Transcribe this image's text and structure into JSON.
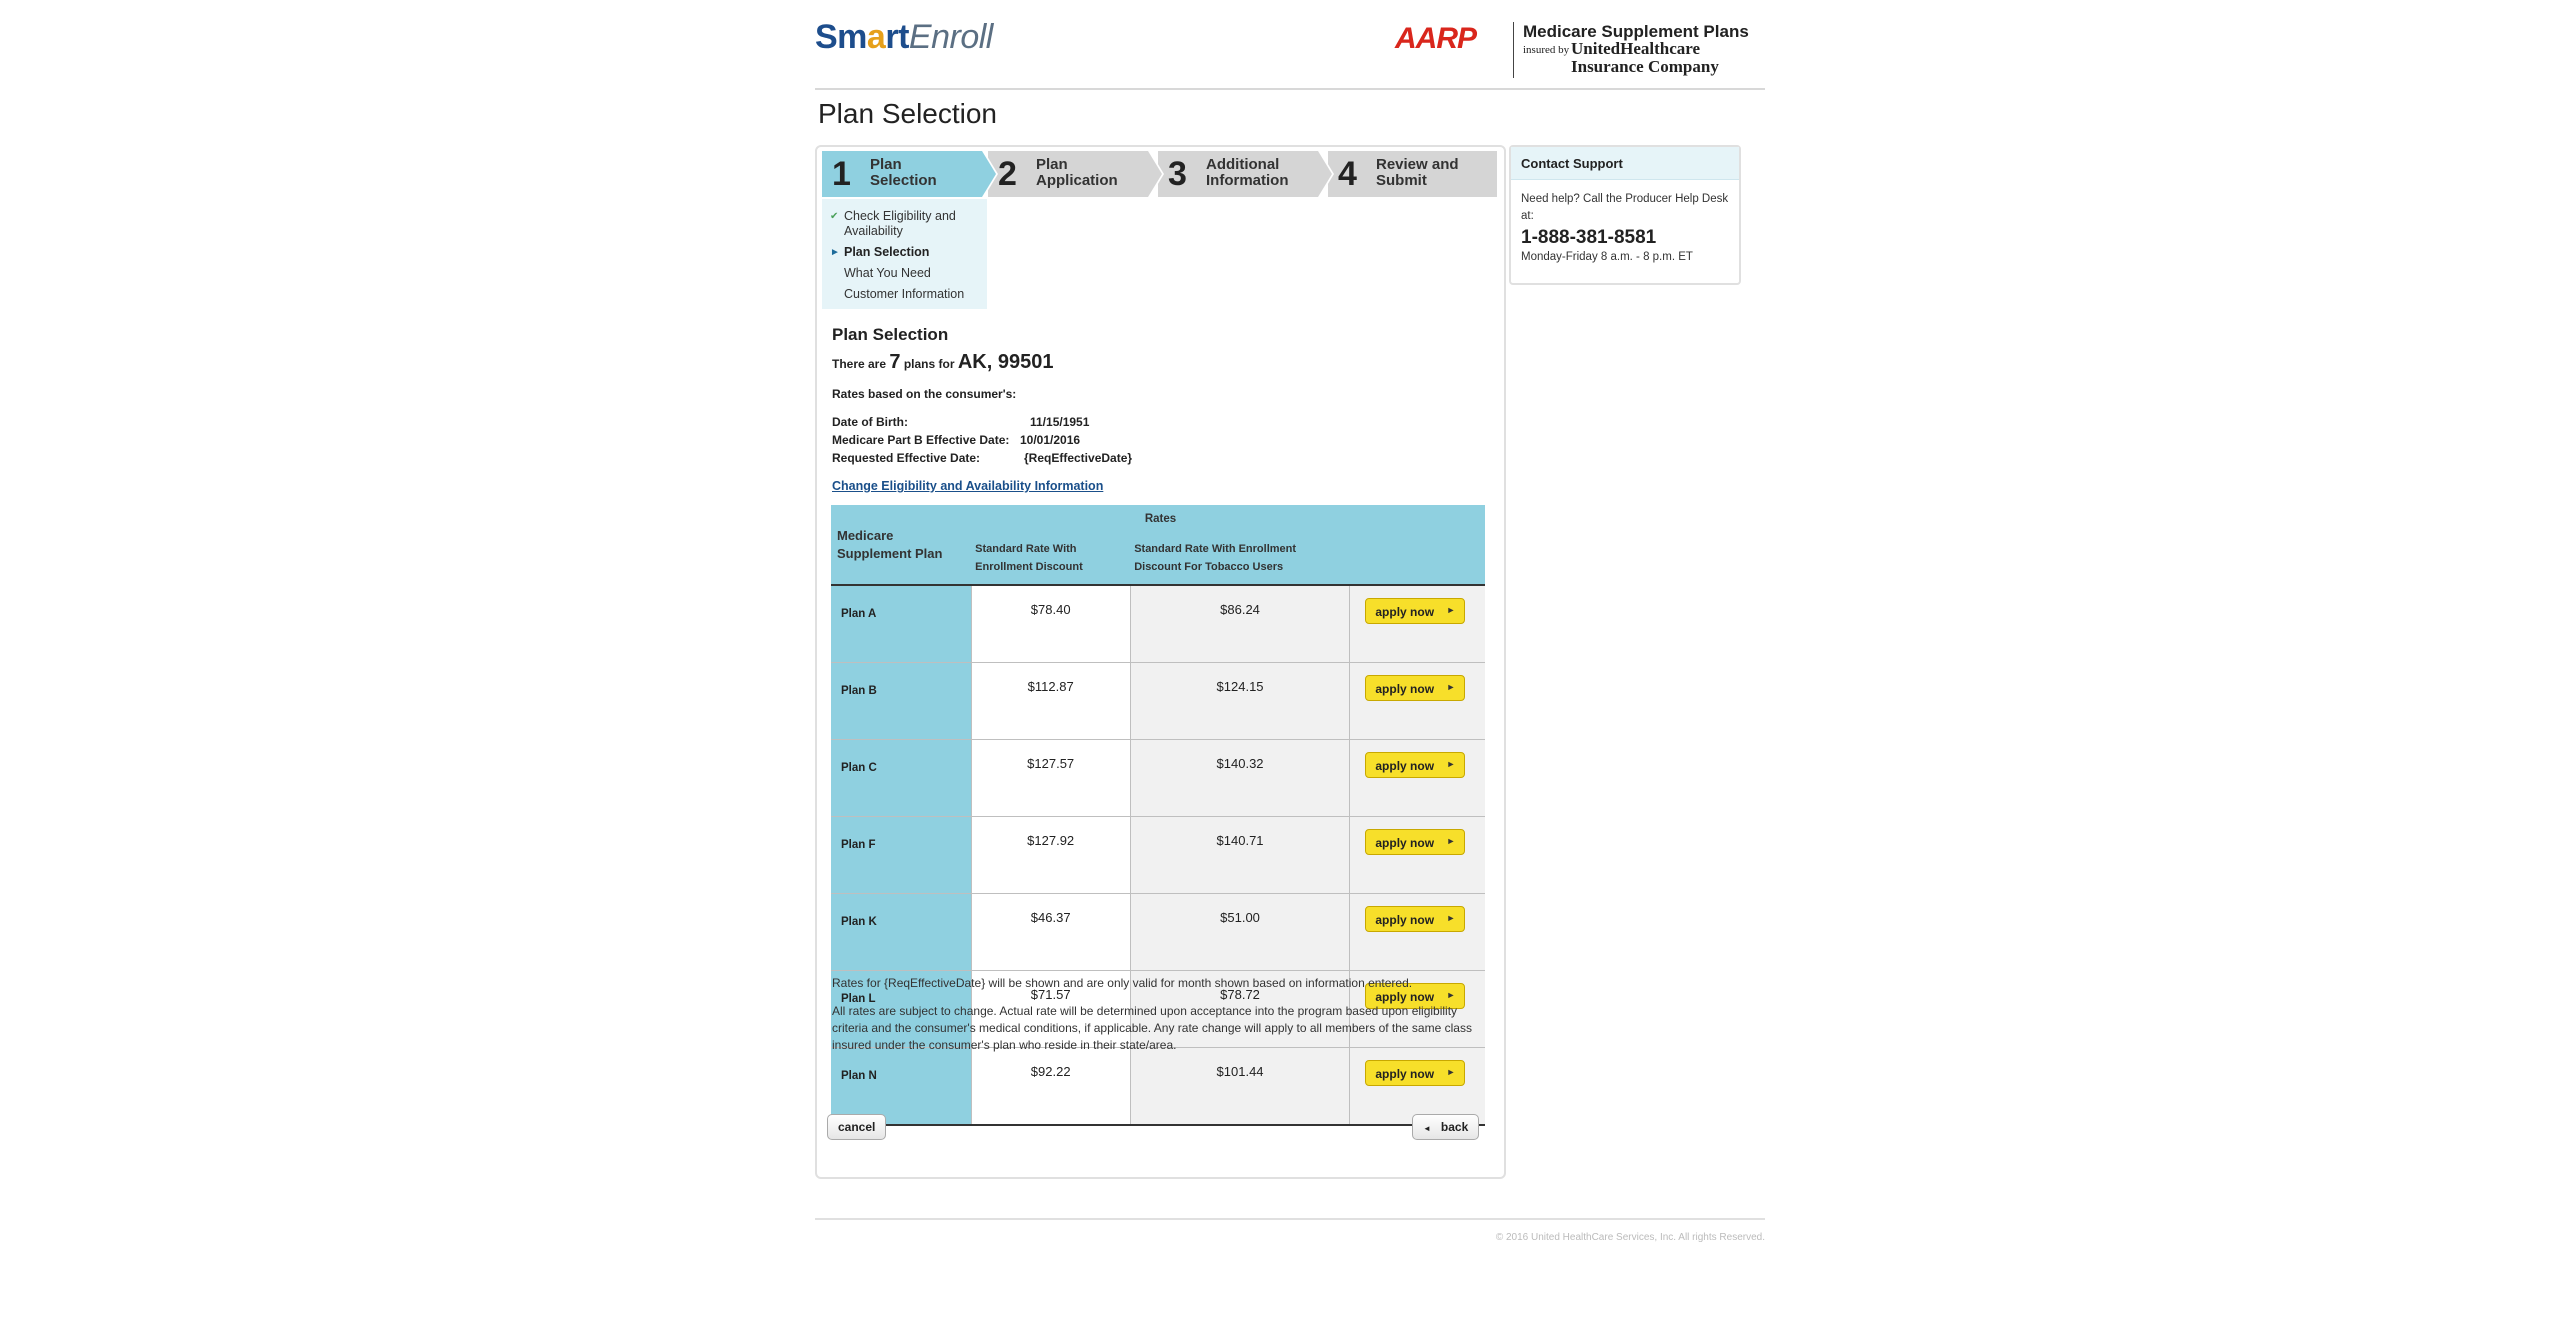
{
  "header": {
    "logo_smart": "Sm",
    "logo_bulb": "a",
    "logo_rt": "rt",
    "logo_enroll": "Enroll",
    "aarp_logo": "AARP",
    "aarp_title": "Medicare Supplement Plans",
    "aarp_insured": "insured by",
    "aarp_company_line1": "UnitedHealthcare",
    "aarp_company_line2": "Insurance Company"
  },
  "page_title": "Plan Selection",
  "steps": [
    {
      "num": "1",
      "label_line1": "Plan",
      "label_line2": "Selection",
      "active": true
    },
    {
      "num": "2",
      "label_line1": "Plan",
      "label_line2": "Application",
      "active": false
    },
    {
      "num": "3",
      "label_line1": "Additional",
      "label_line2": "Information",
      "active": false
    },
    {
      "num": "4",
      "label_line1": "Review and",
      "label_line2": "Submit",
      "active": false
    }
  ],
  "substeps": [
    {
      "label_line1": "Check Eligibility and",
      "label_line2": "Availability",
      "state": "done"
    },
    {
      "label_line1": "Plan Selection",
      "state": "current"
    },
    {
      "label_line1": "What You Need",
      "state": "todo"
    },
    {
      "label_line1": "Customer Information",
      "state": "todo"
    }
  ],
  "main": {
    "section_title": "Plan Selection",
    "count_prefix": "There are ",
    "count_value": "7",
    "count_mid": " plans for ",
    "count_location": "AK, 99501",
    "rates_based": "Rates based on the consumer's:",
    "dob_label": "Date of Birth:",
    "dob_value": "11/15/1951",
    "partb_label": "Medicare Part B Effective Date:",
    "partb_value": "10/01/2016",
    "req_label": "Requested Effective Date:",
    "req_value": "{ReqEffectiveDate}",
    "change_link": "Change Eligibility and Availability Information"
  },
  "table": {
    "col_plan": "Medicare Supplement Plan",
    "col_rates": "Rates",
    "col_std": "Standard Rate With Enrollment Discount",
    "col_tobacco": "Standard Rate With Enrollment Discount For Tobacco Users",
    "apply_label": "apply now",
    "rows": [
      {
        "plan": "Plan A",
        "std": "$78.40",
        "tobacco": "$86.24"
      },
      {
        "plan": "Plan B",
        "std": "$112.87",
        "tobacco": "$124.15"
      },
      {
        "plan": "Plan C",
        "std": "$127.57",
        "tobacco": "$140.32"
      },
      {
        "plan": "Plan F",
        "std": "$127.92",
        "tobacco": "$140.71"
      },
      {
        "plan": "Plan K",
        "std": "$46.37",
        "tobacco": "$51.00"
      },
      {
        "plan": "Plan L",
        "std": "$71.57",
        "tobacco": "$78.72"
      },
      {
        "plan": "Plan N",
        "std": "$92.22",
        "tobacco": "$101.44"
      }
    ]
  },
  "notes": {
    "note1": "Rates for {ReqEffectiveDate} will be shown and are only valid for month shown based on information entered.",
    "note2": "All rates are subject to change. Actual rate will be determined upon acceptance into the program based upon eligibility criteria and the consumer's medical conditions, if applicable. Any rate change will apply to all members of the same class insured under the consumer's plan who reside in their state/area."
  },
  "buttons": {
    "cancel": "cancel",
    "back": "back"
  },
  "contact": {
    "title": "Contact Support",
    "help": "Need help? Call the Producer Help Desk at:",
    "phone": "1-888-381-8581",
    "hours": "Monday-Friday 8 a.m. - 8 p.m. ET"
  },
  "footer": {
    "copyright": "© 2016 United HealthCare Services, Inc. All rights Reserved."
  },
  "colors": {
    "accent_blue": "#8fd0e0",
    "light_blue": "#e6f4f8",
    "apply_yellow": "#f7df2a",
    "aarp_red": "#d9261c",
    "link_blue": "#1a4f8a"
  }
}
